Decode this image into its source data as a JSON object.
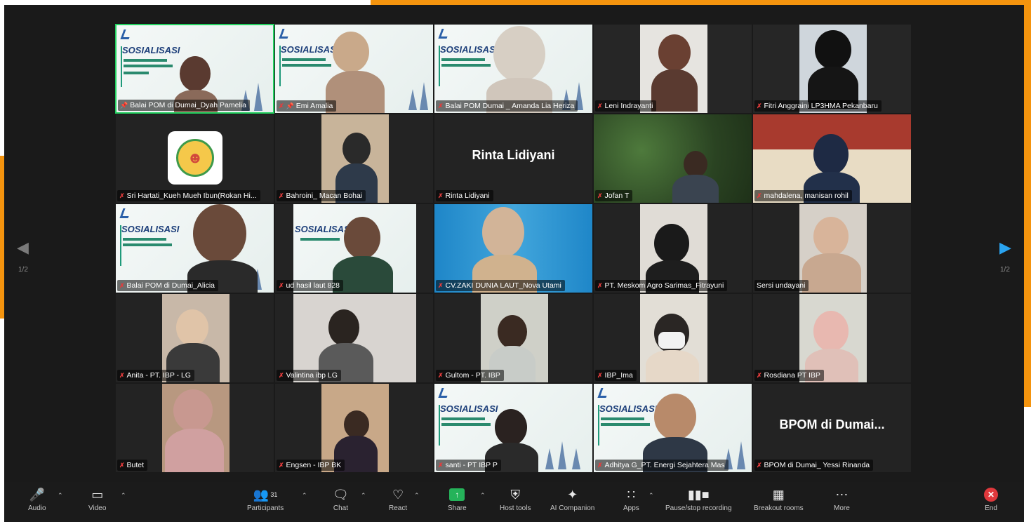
{
  "pager": {
    "left": "1/2",
    "right": "1/2"
  },
  "slide_text": {
    "title": "SOSIALISASI"
  },
  "tiles": [
    {
      "name": "Balai POM di Dumai_Dyah Pamelia",
      "pinned": true,
      "kind": "slide"
    },
    {
      "name": "Emi Amalia",
      "pinned": true,
      "kind": "slide"
    },
    {
      "name": "Balai POM Dumai _ Amanda Lia Heriza",
      "kind": "slide"
    },
    {
      "name": "Leni Indrayanti",
      "kind": "video"
    },
    {
      "name": "Fitri Anggraini LP3HMA Pekanbaru",
      "kind": "video"
    },
    {
      "name": "Sri Hartati_Kueh Mueh Ibun(Rokan Hi...",
      "kind": "avatar"
    },
    {
      "name": "Bahroini_ Macan Bohai",
      "kind": "video"
    },
    {
      "name": "Rinta Lidiyani",
      "kind": "name",
      "display": "Rinta Lidiyani"
    },
    {
      "name": "Jofan T",
      "kind": "video"
    },
    {
      "name": "mahdalena, manisan rohil",
      "kind": "video"
    },
    {
      "name": "Balai POM di Dumai_Alicia",
      "kind": "slide"
    },
    {
      "name": "ud hasil laut 828",
      "kind": "slide"
    },
    {
      "name": "CV.ZAKI DUNIA LAUT_Nova Utami",
      "kind": "video"
    },
    {
      "name": "PT. Meskom Agro Sarimas_Fitrayuni",
      "kind": "video"
    },
    {
      "name": "Sersi undayani",
      "kind": "video",
      "unmuted": true
    },
    {
      "name": "Anita - PT. IBP - LG",
      "kind": "video"
    },
    {
      "name": "Valintina ibp LG",
      "kind": "video"
    },
    {
      "name": "Gultom - PT. IBP",
      "kind": "video"
    },
    {
      "name": "IBP_Ima",
      "kind": "video"
    },
    {
      "name": "Rosdiana PT IBP",
      "kind": "video"
    },
    {
      "name": "Butet",
      "kind": "video"
    },
    {
      "name": "Engsen - IBP BK",
      "kind": "video"
    },
    {
      "name": "santi - PT IBP P",
      "kind": "slide"
    },
    {
      "name": "Adhitya G_PT. Energi Sejahtera Mas",
      "kind": "slide"
    },
    {
      "name": "BPOM di Dumai_ Yessi Rinanda",
      "kind": "name",
      "display": "BPOM di Dumai..."
    }
  ],
  "toolbar": {
    "audio": "Audio",
    "video": "Video",
    "participants": "Participants",
    "participants_count": "31",
    "chat": "Chat",
    "react": "React",
    "share": "Share",
    "host_tools": "Host tools",
    "ai_companion": "AI Companion",
    "apps": "Apps",
    "pause_recording": "Pause/stop recording",
    "breakout_rooms": "Breakout rooms",
    "more": "More",
    "end": "End"
  },
  "colors": {
    "accent_green": "#23d160",
    "end_red": "#e0383c",
    "share_green": "#25b35a",
    "frame_orange": "#f4940e"
  }
}
